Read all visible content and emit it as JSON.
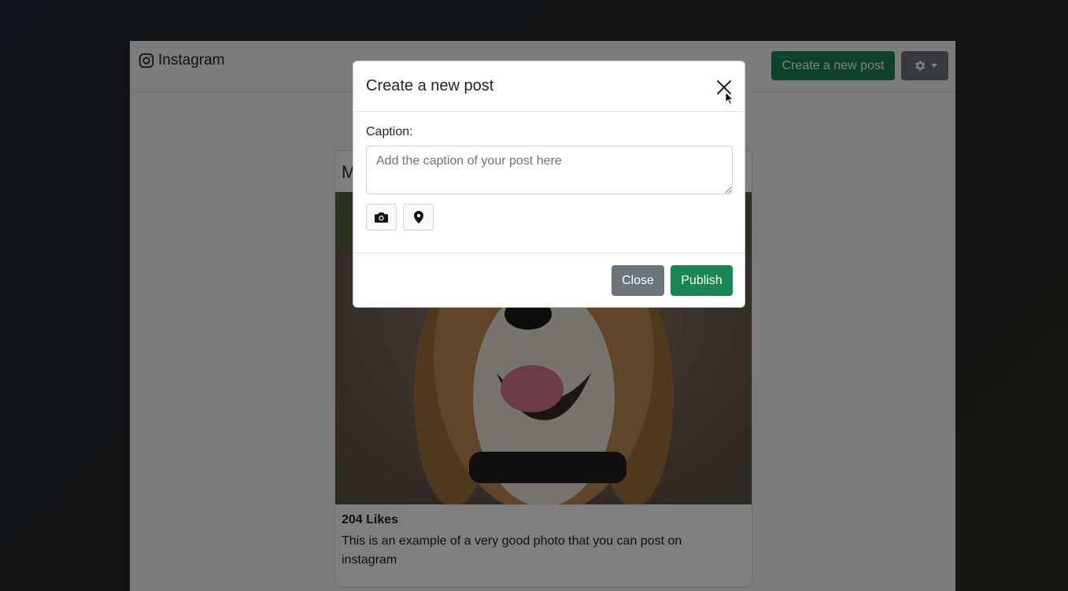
{
  "navbar": {
    "brand": "Instagram",
    "new_post_label": "Create a new post",
    "settings_icon": "gear-icon"
  },
  "post": {
    "username_initial": "M",
    "likes": "204 Likes",
    "description": "This is an example of a very good photo that you can post on instagram"
  },
  "modal": {
    "title": "Create a new post",
    "caption_label": "Caption:",
    "caption_placeholder": "Add the caption of your post here",
    "caption_value": "",
    "close_label": "Close",
    "publish_label": "Publish"
  },
  "colors": {
    "primary_green": "#198754",
    "secondary_gray": "#6c757d"
  }
}
